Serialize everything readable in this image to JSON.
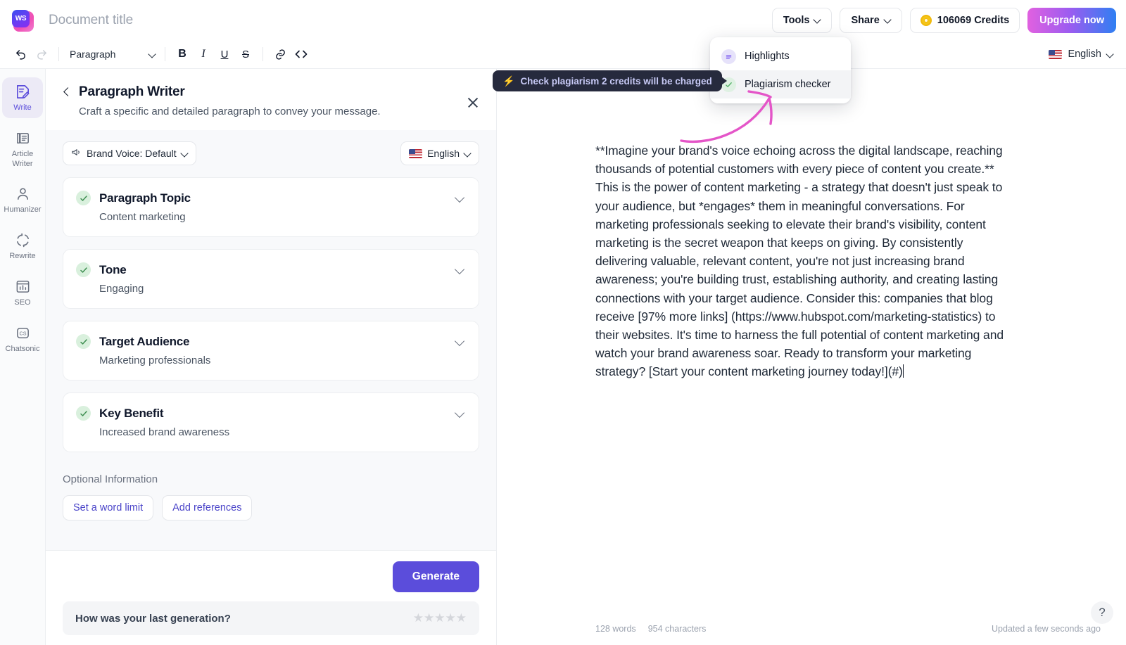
{
  "app": {
    "logo_text": "WS",
    "document_title": "Document title"
  },
  "topbar": {
    "tools_label": "Tools",
    "share_label": "Share",
    "credits_label": "106069 Credits",
    "upgrade_label": "Upgrade now"
  },
  "toolbar": {
    "undo_icon": "undo-icon",
    "redo_icon": "redo-icon",
    "block_type": "Paragraph",
    "bold_label": "B",
    "italic_label": "I",
    "underline_label": "U",
    "strike_label": "S",
    "link_icon": "link-icon",
    "code_icon": "code-icon",
    "language": "English"
  },
  "tools_dropdown": {
    "items": [
      {
        "label": "Highlights",
        "icon": "highlights-icon",
        "highlighted": false
      },
      {
        "label": "Plagiarism checker",
        "icon": "check-circle-icon",
        "highlighted": true
      }
    ]
  },
  "tooltip": {
    "icon": "lightning-bolt-icon",
    "text": "Check plagiarism 2 credits will be charged"
  },
  "sidebar": {
    "items": [
      {
        "label": "Write",
        "icon": "write-icon",
        "active": true
      },
      {
        "label": "Article Writer",
        "icon": "article-writer-icon",
        "active": false
      },
      {
        "label": "Humanizer",
        "icon": "person-icon",
        "active": false
      },
      {
        "label": "Rewrite",
        "icon": "rewrite-icon",
        "active": false
      },
      {
        "label": "SEO",
        "icon": "seo-chart-icon",
        "active": false
      },
      {
        "label": "Chatsonic",
        "icon": "chatsonic-icon",
        "active": false
      }
    ]
  },
  "panel": {
    "title": "Paragraph Writer",
    "subtitle": "Craft a specific and detailed paragraph to convey your message.",
    "brand_voice": "Brand Voice: Default",
    "language": "English",
    "fields": [
      {
        "label": "Paragraph Topic",
        "value": "Content marketing"
      },
      {
        "label": "Tone",
        "value": "Engaging"
      },
      {
        "label": "Target Audience",
        "value": "Marketing professionals"
      },
      {
        "label": "Key Benefit",
        "value": "Increased brand awareness"
      }
    ],
    "optional_label": "Optional Information",
    "optional_buttons": [
      "Set a word limit",
      "Add references"
    ],
    "generate_label": "Generate",
    "rating_question": "How was your last generation?",
    "stars": "★★★★★"
  },
  "document": {
    "body": "**Imagine your brand's voice echoing across the digital landscape, reaching thousands of potential customers with every piece of content you create.** This is the power of content marketing - a strategy that doesn't just speak to your audience, but *engages* them in meaningful conversations. For marketing professionals seeking to elevate their brand's visibility, content marketing is the secret weapon that keeps on giving. By consistently delivering valuable, relevant content, you're not just increasing brand awareness; you're building trust, establishing authority, and creating lasting connections with your target audience. Consider this: companies that blog receive [97% more links] (https://www.hubspot.com/marketing-statistics) to their websites. It's time to harness the full potential of content marketing and watch your brand awareness soar. Ready to transform your marketing strategy? [Start your content marketing journey today!](#)",
    "word_count": "128 words",
    "char_count": "954 characters",
    "updated": "Updated a few seconds ago",
    "help_label": "?"
  },
  "colors": {
    "accent_purple": "#5b4ddb",
    "tooltip_bg": "#262a3d",
    "annotation_pink": "#e455c8",
    "check_green": "#3f8f52"
  }
}
